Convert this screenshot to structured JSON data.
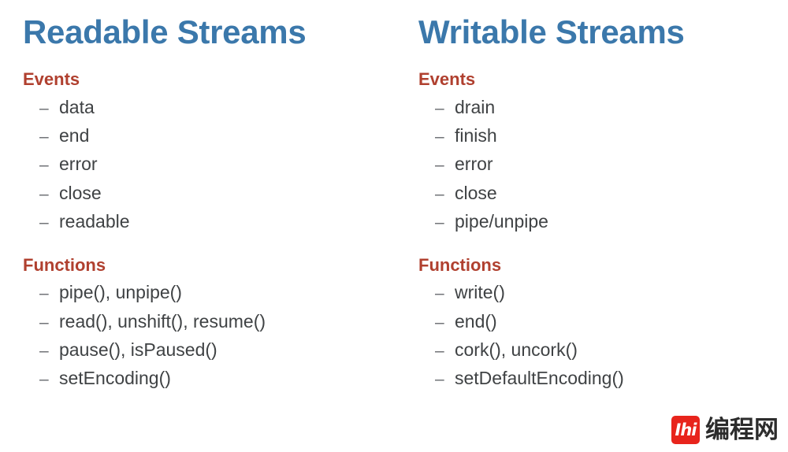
{
  "slide": {
    "background_color": "#ffffff",
    "title_color": "#3b78ab",
    "heading_color": "#b0402f",
    "body_color": "#3f4244",
    "bullet_glyph": "–"
  },
  "columns": [
    {
      "title": "Readable Streams",
      "sections": [
        {
          "heading": "Events",
          "items": [
            "data",
            "end",
            "error",
            "close",
            "readable"
          ]
        },
        {
          "heading": "Functions",
          "items": [
            "pipe(), unpipe()",
            "read(), unshift(), resume()",
            "pause(), isPaused()",
            "setEncoding()"
          ]
        }
      ]
    },
    {
      "title": "Writable Streams",
      "sections": [
        {
          "heading": "Events",
          "items": [
            "drain",
            "finish",
            "error",
            "close",
            "pipe/unpipe"
          ]
        },
        {
          "heading": "Functions",
          "items": [
            "write()",
            "end()",
            "cork(), uncork()",
            "setDefaultEncoding()"
          ]
        }
      ]
    }
  ],
  "watermark": {
    "mark_text": "Ihi",
    "label": "编程网",
    "mark_color": "#e8241c",
    "text_color": "#2c2c2c"
  }
}
